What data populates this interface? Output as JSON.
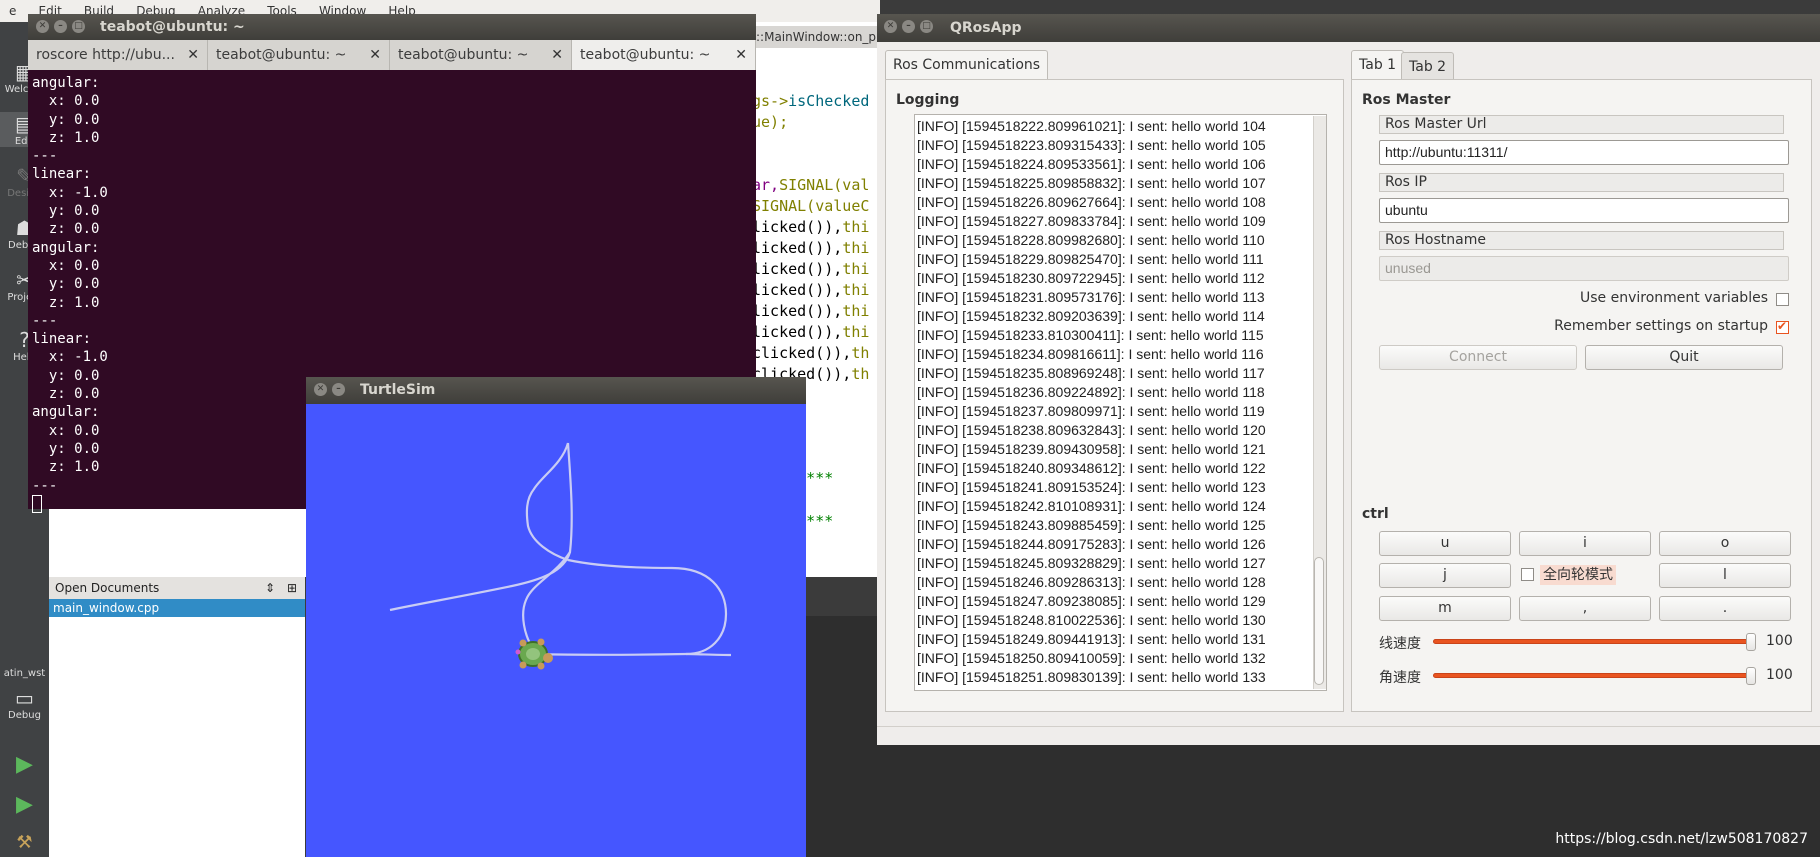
{
  "qtcreator": {
    "menu": [
      "e",
      "Edit",
      "Build",
      "Debug",
      "Analyze",
      "Tools",
      "Window",
      "Help"
    ],
    "modes": [
      {
        "label": "Welcom",
        "icon": "grid-icon"
      },
      {
        "label": "Edit",
        "icon": "edit-icon"
      },
      {
        "label": "Design",
        "icon": "pencil-icon"
      },
      {
        "label": "Debug",
        "icon": "bug-icon"
      },
      {
        "label": "Project",
        "icon": "wrench-icon"
      },
      {
        "label": "Help",
        "icon": "help-icon"
      }
    ],
    "kit_label": "atin_wst",
    "kit_mode": "Debug",
    "editor_header": "::MainWindow::on_pus",
    "code_lines": [
      {
        "a": "gs->",
        "b": "isChecked"
      },
      {
        "a": "ue);",
        "b": ""
      },
      {
        "a": "ar,",
        "b": "SIGNAL(val"
      },
      {
        "a": "SIGNAL(valueC",
        "b": ""
      },
      {
        "a": "licked()),",
        "b": "thi"
      },
      {
        "a": "licked()),",
        "b": "thi"
      },
      {
        "a": "licked()),",
        "b": "thi"
      },
      {
        "a": "licked()),",
        "b": "thi"
      },
      {
        "a": "licked()),",
        "b": "thi"
      },
      {
        "a": "licked()),",
        "b": "thi"
      },
      {
        "a": "clicked()),",
        "b": "th"
      },
      {
        "a": "clicked()),",
        "b": "th"
      }
    ],
    "stars": "*********",
    "open_docs_title": "Open Documents",
    "open_docs_item": "main_window.cpp"
  },
  "terminal": {
    "title": "teabot@ubuntu: ~",
    "tabs": [
      "roscore http://ubu...",
      "teabot@ubuntu: ~",
      "teabot@ubuntu: ~",
      "teabot@ubuntu: ~"
    ],
    "lines": [
      "angular:",
      "  x: 0.0",
      "  y: 0.0",
      "  z: 1.0",
      "---",
      "linear:",
      "  x: -1.0",
      "  y: 0.0",
      "  z: 0.0",
      "angular:",
      "  x: 0.0",
      "  y: 0.0",
      "  z: 1.0",
      "---",
      "linear:",
      "  x: -1.0",
      "  y: 0.0",
      "  z: 0.0",
      "angular:",
      "  x: 0.0",
      "  y: 0.0",
      "  z: 1.0",
      "---"
    ]
  },
  "turtlesim": {
    "title": "TurtleSim",
    "background": "#4556ff",
    "trail_color": "#c9ccf4"
  },
  "qros": {
    "title": "QRosApp",
    "left_tab": "Ros Communications",
    "logging_title": "Logging",
    "logs": [
      "[INFO] [1594518222.809961021]: I sent: hello world 104",
      "[INFO] [1594518223.809315433]: I sent: hello world 105",
      "[INFO] [1594518224.809533561]: I sent: hello world 106",
      "[INFO] [1594518225.809858832]: I sent: hello world 107",
      "[INFO] [1594518226.809627664]: I sent: hello world 108",
      "[INFO] [1594518227.809833784]: I sent: hello world 109",
      "[INFO] [1594518228.809982680]: I sent: hello world 110",
      "[INFO] [1594518229.809825470]: I sent: hello world 111",
      "[INFO] [1594518230.809722945]: I sent: hello world 112",
      "[INFO] [1594518231.809573176]: I sent: hello world 113",
      "[INFO] [1594518232.809203639]: I sent: hello world 114",
      "[INFO] [1594518233.810300411]: I sent: hello world 115",
      "[INFO] [1594518234.809816611]: I sent: hello world 116",
      "[INFO] [1594518235.808969248]: I sent: hello world 117",
      "[INFO] [1594518236.809224892]: I sent: hello world 118",
      "[INFO] [1594518237.809809971]: I sent: hello world 119",
      "[INFO] [1594518238.809632843]: I sent: hello world 120",
      "[INFO] [1594518239.809430958]: I sent: hello world 121",
      "[INFO] [1594518240.809348612]: I sent: hello world 122",
      "[INFO] [1594518241.809153524]: I sent: hello world 123",
      "[INFO] [1594518242.810108931]: I sent: hello world 124",
      "[INFO] [1594518243.809885459]: I sent: hello world 125",
      "[INFO] [1594518244.809175283]: I sent: hello world 126",
      "[INFO] [1594518245.809328829]: I sent: hello world 127",
      "[INFO] [1594518246.809286313]: I sent: hello world 128",
      "[INFO] [1594518247.809238085]: I sent: hello world 129",
      "[INFO] [1594518248.810022536]: I sent: hello world 130",
      "[INFO] [1594518249.809441913]: I sent: hello world 131",
      "[INFO] [1594518250.809410059]: I sent: hello world 132",
      "[INFO] [1594518251.809830139]: I sent: hello world 133"
    ],
    "right_tabs": [
      "Tab 1",
      "Tab 2"
    ],
    "ros_master_title": "Ros Master",
    "master_url_label": "Ros Master Url",
    "master_url_value": "http://ubuntu:11311/",
    "ros_ip_label": "Ros IP",
    "ros_ip_value": "ubuntu",
    "hostname_label": "Ros Hostname",
    "hostname_value": "unused",
    "use_env_label": "Use environment variables",
    "use_env_checked": false,
    "remember_label": "Remember settings on startup",
    "remember_checked": true,
    "connect_label": "Connect",
    "quit_label": "Quit",
    "ctrl_title": "ctrl",
    "keys": [
      "u",
      "i",
      "o",
      "j",
      "l",
      "m",
      ",",
      "."
    ],
    "omni_label": "全向轮模式",
    "linear_label": "线速度",
    "linear_value": "100",
    "angular_label": "角速度",
    "angular_value": "100",
    "accent": "#e95420"
  },
  "watermark": "https://blog.csdn.net/lzw508170827"
}
